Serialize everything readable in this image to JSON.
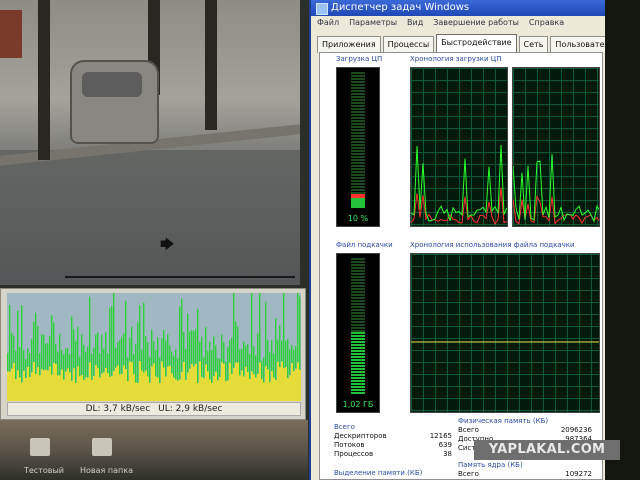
{
  "taskmgr": {
    "title": "Диспетчер задач Windows",
    "menu": [
      "Файл",
      "Параметры",
      "Вид",
      "Завершение работы",
      "Справка"
    ],
    "tabs": [
      "Приложения",
      "Процессы",
      "Быстродействие",
      "Сеть",
      "Пользователи"
    ],
    "active_tab": "Быстродействие",
    "cpu": {
      "label": "Загрузка ЦП",
      "value_text": "10 %",
      "fraction": 0.1,
      "history_label": "Хронология загрузки ЦП"
    },
    "pagefile": {
      "label": "Файл подкачки",
      "value_text": "1,02 ГБ",
      "fraction": 0.45,
      "history_label": "Хронология использования файла подкачки"
    },
    "totals": {
      "head": "Всего",
      "rows": [
        {
          "label": "Дескрипторов",
          "value": "12165"
        },
        {
          "label": "Потоков",
          "value": "639"
        },
        {
          "label": "Процессов",
          "value": "38"
        }
      ]
    },
    "physical": {
      "head": "Физическая память (КБ)",
      "rows": [
        {
          "label": "Всего",
          "value": "2096236"
        },
        {
          "label": "Доступно",
          "value": "987364"
        },
        {
          "label": "Системный кэш",
          "value": ""
        }
      ]
    },
    "commit_label": "Выделение памяти (КБ)",
    "kernel": {
      "head": "Память ядра (КБ)",
      "rows": [
        {
          "label": "Всего",
          "value": "109272"
        }
      ]
    }
  },
  "traffic": {
    "dl": "DL: 3,7 kB/sec",
    "ul": "UL: 2,9 kB/sec"
  },
  "desktop": {
    "icons": [
      "Тестовый",
      "Новая папка"
    ]
  },
  "watermark": "YAPLAKAL.COM",
  "colors": {
    "meter_green": "#23c23a",
    "graph_grid": "#0a5a36",
    "cpu_green_line": "#2cff2c",
    "cpu_red_line": "#ff3030",
    "pagefile_line": "#e6e64a",
    "traffic_green": "#2fd13a",
    "traffic_yellow": "#e5dc3a"
  }
}
